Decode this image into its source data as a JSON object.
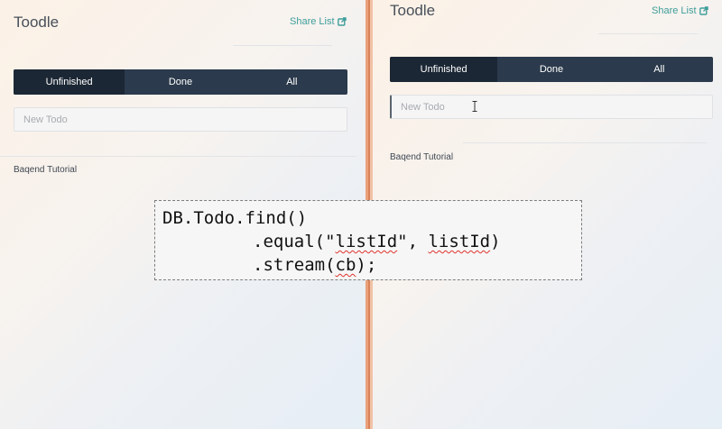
{
  "panes": [
    {
      "id": "left",
      "app_title": "Toodle",
      "share_label": "Share List",
      "filters": [
        {
          "label": "Unfinished",
          "active": true
        },
        {
          "label": "Done",
          "active": false
        },
        {
          "label": "All",
          "active": false
        }
      ],
      "new_todo_placeholder": "New Todo",
      "section_label": "Baqend Tutorial"
    },
    {
      "id": "right",
      "app_title": "Toodle",
      "share_label": "Share List",
      "filters": [
        {
          "label": "Unfinished",
          "active": true
        },
        {
          "label": "Done",
          "active": false
        },
        {
          "label": "All",
          "active": false
        }
      ],
      "new_todo_placeholder": "New Todo",
      "section_label": "Baqend Tutorial"
    }
  ],
  "code_snippet": {
    "line1": "DB.Todo.find()",
    "line2_pre": ".equal(\"",
    "line2_key": "listId",
    "line2_mid": "\", ",
    "line2_arg": "listId",
    "line2_post": ")",
    "line3_pre": ".stream(",
    "line3_arg": "cb",
    "line3_post": ");"
  },
  "colors": {
    "accent_teal": "#3e9e9a",
    "segment_bg": "#2b3a4c",
    "segment_active": "#1c2735",
    "divider": "#e39e78"
  },
  "icons": {
    "share": "share-external-icon",
    "cursor": "text-cursor-icon"
  }
}
